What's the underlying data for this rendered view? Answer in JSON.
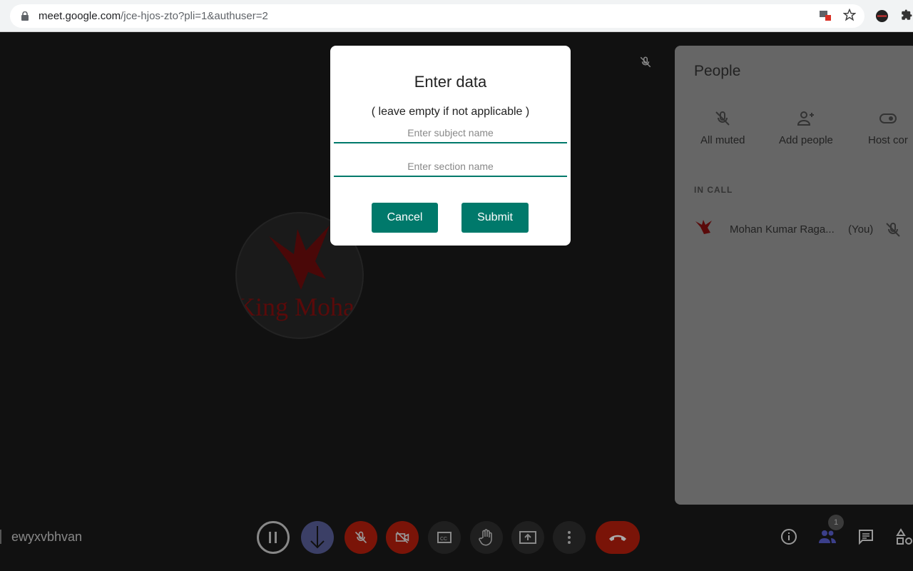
{
  "browser": {
    "url_host": "meet.google.com",
    "url_path": "/jce-hjos-zto?pli=1&authuser=2"
  },
  "dialog": {
    "title": "Enter data",
    "subtitle": "( leave empty if not applicable )",
    "subject_placeholder": "Enter subject name",
    "subject_value": "",
    "section_placeholder": "Enter section name",
    "section_value": "",
    "cancel_label": "Cancel",
    "submit_label": "Submit",
    "accent": "#00796b"
  },
  "video": {
    "logo_text": "King Mohan",
    "self_name": "ewyxvbhvan"
  },
  "people_panel": {
    "title": "People",
    "actions": [
      {
        "label": "All muted",
        "icon": "mic-off-icon"
      },
      {
        "label": "Add people",
        "icon": "person-add-icon"
      },
      {
        "label": "Host cor",
        "icon": "toggle-icon"
      }
    ],
    "section_label": "IN CALL",
    "participants": [
      {
        "name": "Mohan Kumar Raga...",
        "suffix": "(You)",
        "muted": true
      }
    ]
  },
  "toolbar": {
    "buttons": [
      "pause",
      "download",
      "mic-off",
      "camera-off",
      "captions",
      "raise-hand",
      "present",
      "more",
      "leave-call"
    ],
    "people_count": "1"
  }
}
